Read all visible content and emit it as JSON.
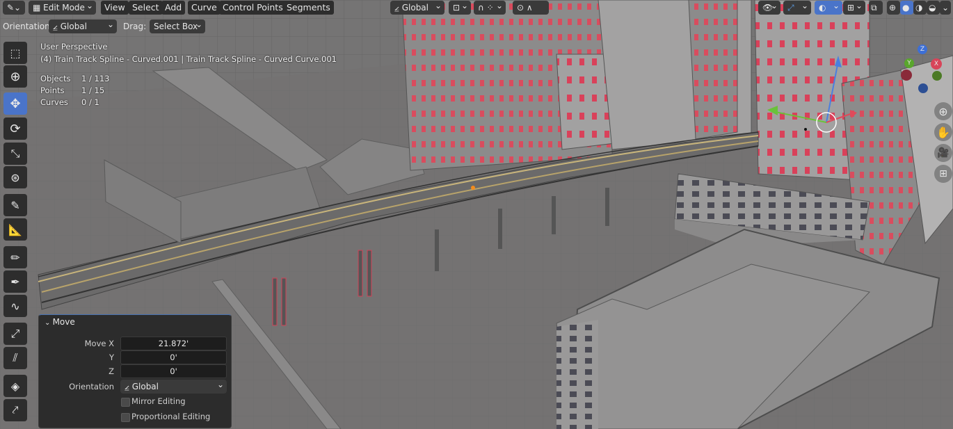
{
  "header": {
    "mode": "Edit Mode",
    "menus": [
      "View",
      "Select",
      "Add",
      "Curve",
      "Control Points",
      "Segments"
    ],
    "transform_orientation": "Global"
  },
  "subheader": {
    "orientation_label": "Orientation:",
    "orientation_value": "Global",
    "drag_label": "Drag:",
    "drag_value": "Select Box"
  },
  "viewport_info": {
    "view_name": "User Perspective",
    "object_line": "(4) Train Track Spline - Curved.001 | Train Track Spline - Curved Curve.001",
    "stats": [
      {
        "label": "Objects",
        "value": "1 / 113"
      },
      {
        "label": "Points",
        "value": "1 / 15"
      },
      {
        "label": "Curves",
        "value": "0 / 1"
      }
    ]
  },
  "gizmo": {
    "x": "X",
    "y": "Y",
    "z": "Z"
  },
  "operator_panel": {
    "title": "Move",
    "move_x_label": "Move X",
    "move_x": "21.872'",
    "y_label": "Y",
    "y": "0'",
    "z_label": "Z",
    "z": "0'",
    "orientation_label": "Orientation",
    "orientation": "Global",
    "mirror_editing": "Mirror Editing",
    "proportional_editing": "Proportional Editing"
  },
  "tools": [
    "select-box",
    "cursor",
    "move",
    "rotate",
    "scale",
    "transform",
    "annotate",
    "measure",
    "draw",
    "pen",
    "curve-draw",
    "radius",
    "tilt",
    "extrude",
    "randomize"
  ],
  "colors": {
    "accent": "#4a74c9",
    "header_bg": "#2d2d2d",
    "panel_bg": "#2c2c2c",
    "viewport": "#6f6e6e"
  }
}
